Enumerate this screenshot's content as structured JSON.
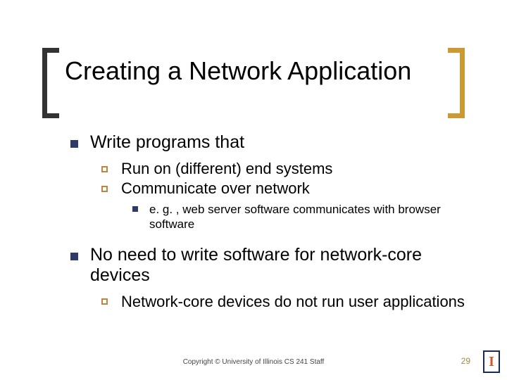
{
  "title": "Creating a Network Application",
  "bullets": {
    "b1": {
      "text": "Write programs that",
      "sub": {
        "s1": "Run on (different) end systems",
        "s2": "Communicate over network",
        "s2sub": {
          "e1": "e. g. , web server software communicates with browser software"
        }
      }
    },
    "b2": {
      "text": "No need to write software for network-core devices",
      "sub": {
        "s1": "Network-core devices do not run user applications"
      }
    }
  },
  "footer": {
    "copyright": "Copyright © University of Illinois CS 241 Staff",
    "page": "29",
    "logo_letter": "I"
  }
}
